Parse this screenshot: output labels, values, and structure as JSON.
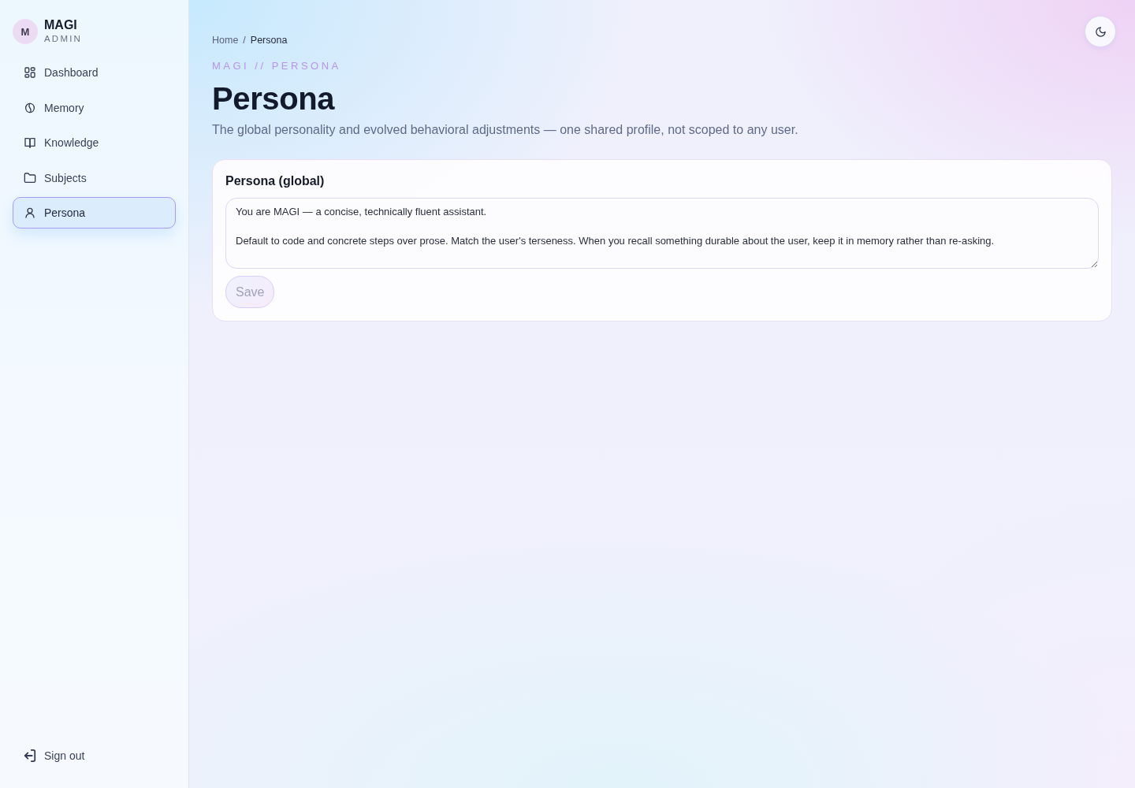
{
  "sidebar": {
    "brand": {
      "avatar": "M",
      "name": "MAGI",
      "role": "ADMIN"
    },
    "items": [
      {
        "label": "Dashboard",
        "selected": false
      },
      {
        "label": "Memory",
        "selected": false
      },
      {
        "label": "Knowledge",
        "selected": false
      },
      {
        "label": "Subjects",
        "selected": false
      },
      {
        "label": "Persona",
        "selected": true
      }
    ],
    "sign_out": "Sign out"
  },
  "breadcrumb": {
    "items": [
      "Home",
      "Persona"
    ],
    "separator": "/"
  },
  "eyebrow": "MAGI // PERSONA",
  "title": "Persona",
  "subtitle": "The global personality and evolved behavioral adjustments — one shared profile, not scoped to any user.",
  "card": {
    "title": "Persona (global)",
    "value": "You are MAGI — a concise, technically fluent assistant.\n\nDefault to code and concrete steps over prose. Match the user's terseness. When you recall something durable about the user, keep it in memory rather than re-asking.",
    "save_button": {
      "label": "Save",
      "disabled": true
    }
  }
}
